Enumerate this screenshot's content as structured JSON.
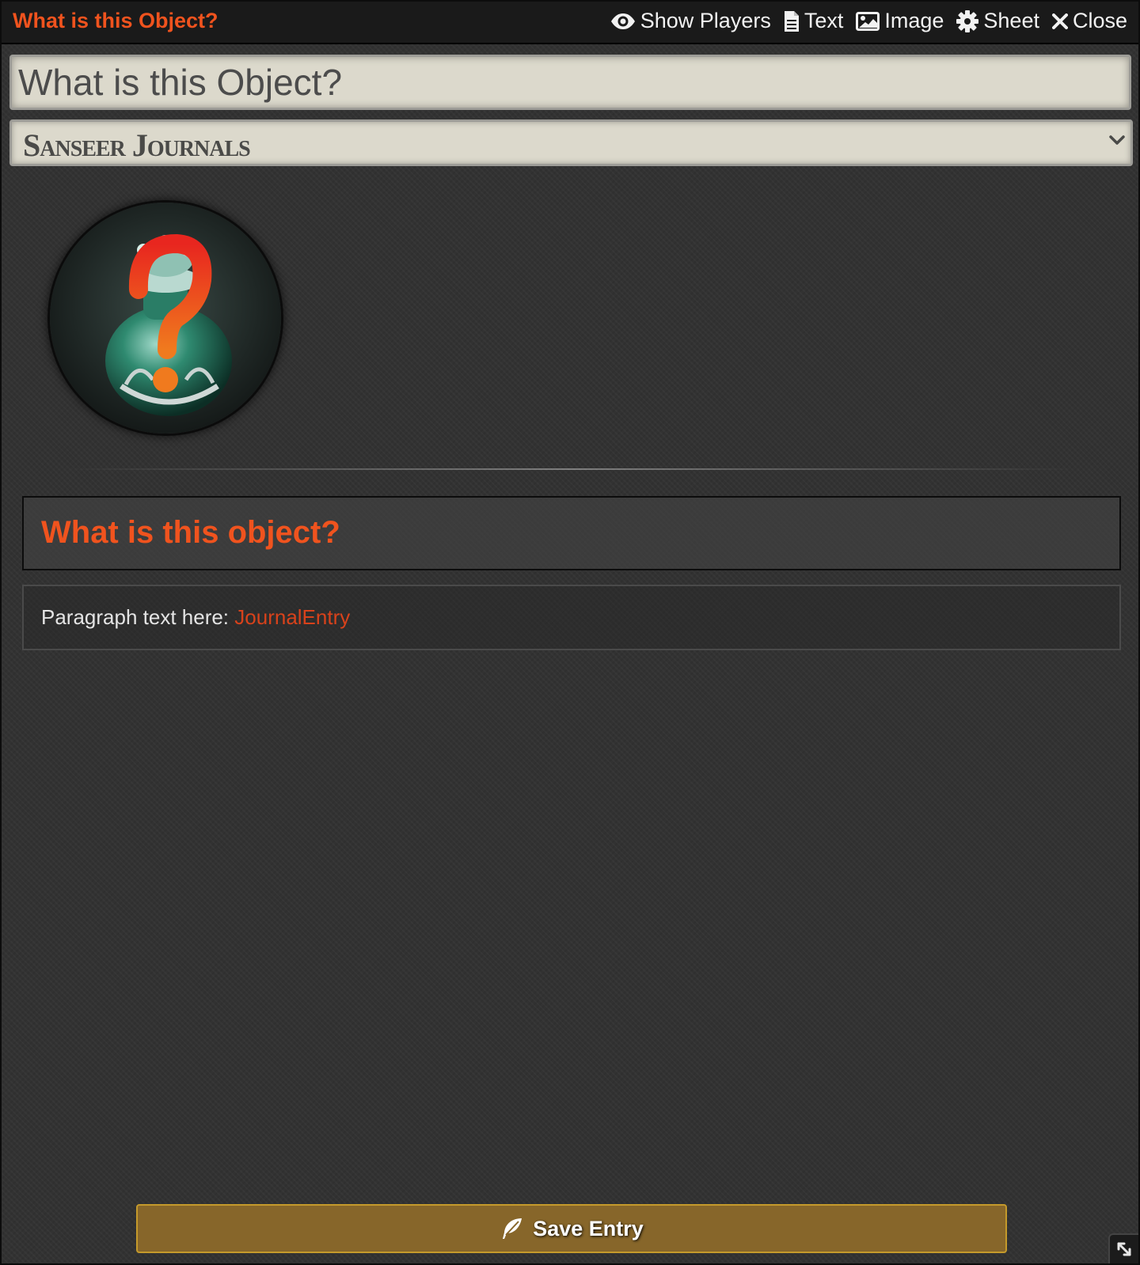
{
  "header": {
    "title": "What is this Object?",
    "controls": {
      "show_players": "Show Players",
      "text": "Text",
      "image": "Image",
      "sheet": "Sheet",
      "close": "Close"
    }
  },
  "form": {
    "title_value": "What is this Object?",
    "folder_selected": "Sanseer Journals"
  },
  "content": {
    "heading": "What is this object?",
    "paragraph_label": "Paragraph text here:",
    "paragraph_link": "JournalEntry"
  },
  "footer": {
    "save_label": "Save Entry"
  },
  "icons": {
    "show_players": "eye-icon",
    "text": "file-text-icon",
    "image": "image-icon",
    "sheet": "gear-icon",
    "close": "close-icon",
    "save": "feather-icon",
    "folder_dropdown": "chevron-down-icon",
    "resize": "resize-icon"
  },
  "colors": {
    "accent": "#f0531e",
    "link": "#d8421b",
    "save_button": "#87662a",
    "save_border": "#c59a2b",
    "input_bg": "#dcd9cc"
  }
}
